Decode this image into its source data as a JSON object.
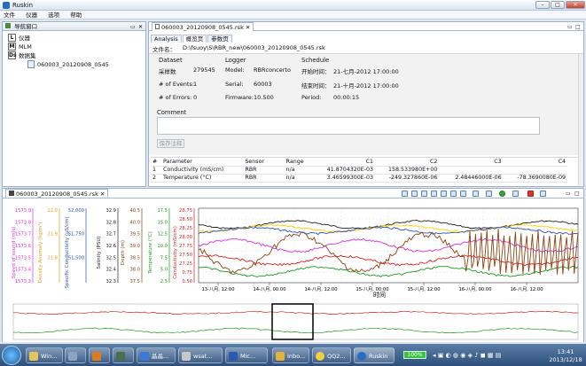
{
  "window": {
    "title": "Ruskin",
    "min": "–",
    "max": "□",
    "close": "✕"
  },
  "menu": [
    "文件",
    "仪器",
    "选项",
    "帮助"
  ],
  "left_panel": {
    "title": "导航窗口",
    "items": [
      {
        "icon": "L",
        "label": "仪器"
      },
      {
        "icon": "M",
        "label": "MLM"
      },
      {
        "icon": "Ds",
        "label": "数据集"
      }
    ],
    "file": "060003_20120908_0545"
  },
  "editor": {
    "tab": "060003_20120908_0545.rsk",
    "subtabs": [
      "Analysis",
      "概览页",
      "参数页"
    ],
    "file_label": "文件名：",
    "file_path": "D:\\fsuoy\\S\\RBR_new\\060003_20120908_0545.rsk",
    "dataset": {
      "title": "Dataset",
      "rows": [
        {
          "label": "采样数",
          "value": "279545"
        },
        {
          "label": "# of Events:",
          "value": "1"
        },
        {
          "label": "# of Errors:",
          "value": "0"
        }
      ]
    },
    "logger": {
      "title": "Logger",
      "rows": [
        {
          "label": "Model:",
          "value": "RBRconcerto"
        },
        {
          "label": "Serial:",
          "value": "60003"
        },
        {
          "label": "Firmware:",
          "value": "10.500"
        }
      ]
    },
    "schedule": {
      "title": "Schedule",
      "rows": [
        {
          "label": "开始时间：",
          "value": "21-七月-2012 17:00:00"
        },
        {
          "label": "结束时间：",
          "value": "21-十月-2012 17:00:00"
        },
        {
          "label": "Period:",
          "value": "00:00:15"
        }
      ]
    },
    "comment_title": "Comment",
    "save_note": "保存注释",
    "table": {
      "headers": [
        "#",
        "Parameter",
        "Sensor",
        "Range",
        "C1",
        "C2",
        "C3",
        "C4"
      ],
      "rows": [
        [
          "1",
          "Conductivity (mS/cm)",
          "RBR",
          "n/a",
          "41.8704320E-03",
          "158.533980E+00",
          "",
          ""
        ],
        [
          "2",
          "Temperature (°C)",
          "RBR",
          "n/a",
          "3.46599300E-03",
          "-249.327860E-06",
          "2.48446000E-06",
          "-78.3690080E-09"
        ]
      ]
    }
  },
  "plot": {
    "tab": "060003_20120908_0545.rsk",
    "xlabel": "时间",
    "xticks": [
      "13-八月, 12:00",
      "14-八月, 00:00",
      "14-八月, 12:00",
      "15-八月, 00:00",
      "15-八月, 12:00",
      "16-八月, 00:00",
      "16-八月, 12:00"
    ],
    "axes": [
      {
        "name": "Speed of sound (m/s)",
        "color": "#d633d6",
        "ticks": [
          "1573.9",
          "1573.8",
          "1573.7",
          "1573.6",
          "1573.5",
          "1573.4",
          "1573.3"
        ]
      },
      {
        "name": "Density Anomaly (kg/m³)",
        "color": "#e0a020",
        "ticks": [
          "22.0",
          "",
          "21.9",
          "",
          "21.8",
          "",
          ""
        ]
      },
      {
        "name": "Specific Conductivity (µS/cm)",
        "color": "#2a52be",
        "ticks": [
          "52,000",
          "",
          "51,750",
          "",
          "51,500",
          "",
          ""
        ]
      },
      {
        "name": "Salinity (PSU)",
        "color": "#222222",
        "ticks": [
          "32.9",
          "32.8",
          "32.7",
          "32.6",
          "32.5",
          "32.4",
          "32.3"
        ]
      },
      {
        "name": "Depth (m)",
        "color": "#8b4513",
        "ticks": [
          "40.5",
          "40.0",
          "39.5",
          "39.0",
          "38.5",
          "38.0",
          "37.5"
        ]
      },
      {
        "name": "Temperature (°C)",
        "color": "#1a9a1a",
        "ticks": [
          "17.5",
          "15.0",
          "12.5",
          "10.0",
          "7.5",
          "5.0",
          "2.5"
        ]
      },
      {
        "name": "Conductivity (mS/cm)",
        "color": "#d42020",
        "ticks": [
          "28.75",
          "28.50",
          "28.25",
          "28.00",
          "27.75",
          "27.50",
          "27.25",
          "0.75",
          "0.50"
        ]
      }
    ]
  },
  "taskbar": {
    "items": [
      "Win...",
      "",
      "",
      "",
      "晶晶...",
      "wsat...",
      "Mic...",
      "Inbo...",
      "QQ2...",
      "Ruskin"
    ],
    "battery": "100%",
    "time": "13:41",
    "date": "2013/12/18"
  },
  "colors": {
    "accent": "#2a6bc2",
    "taskbar": "#2d4f7a"
  }
}
